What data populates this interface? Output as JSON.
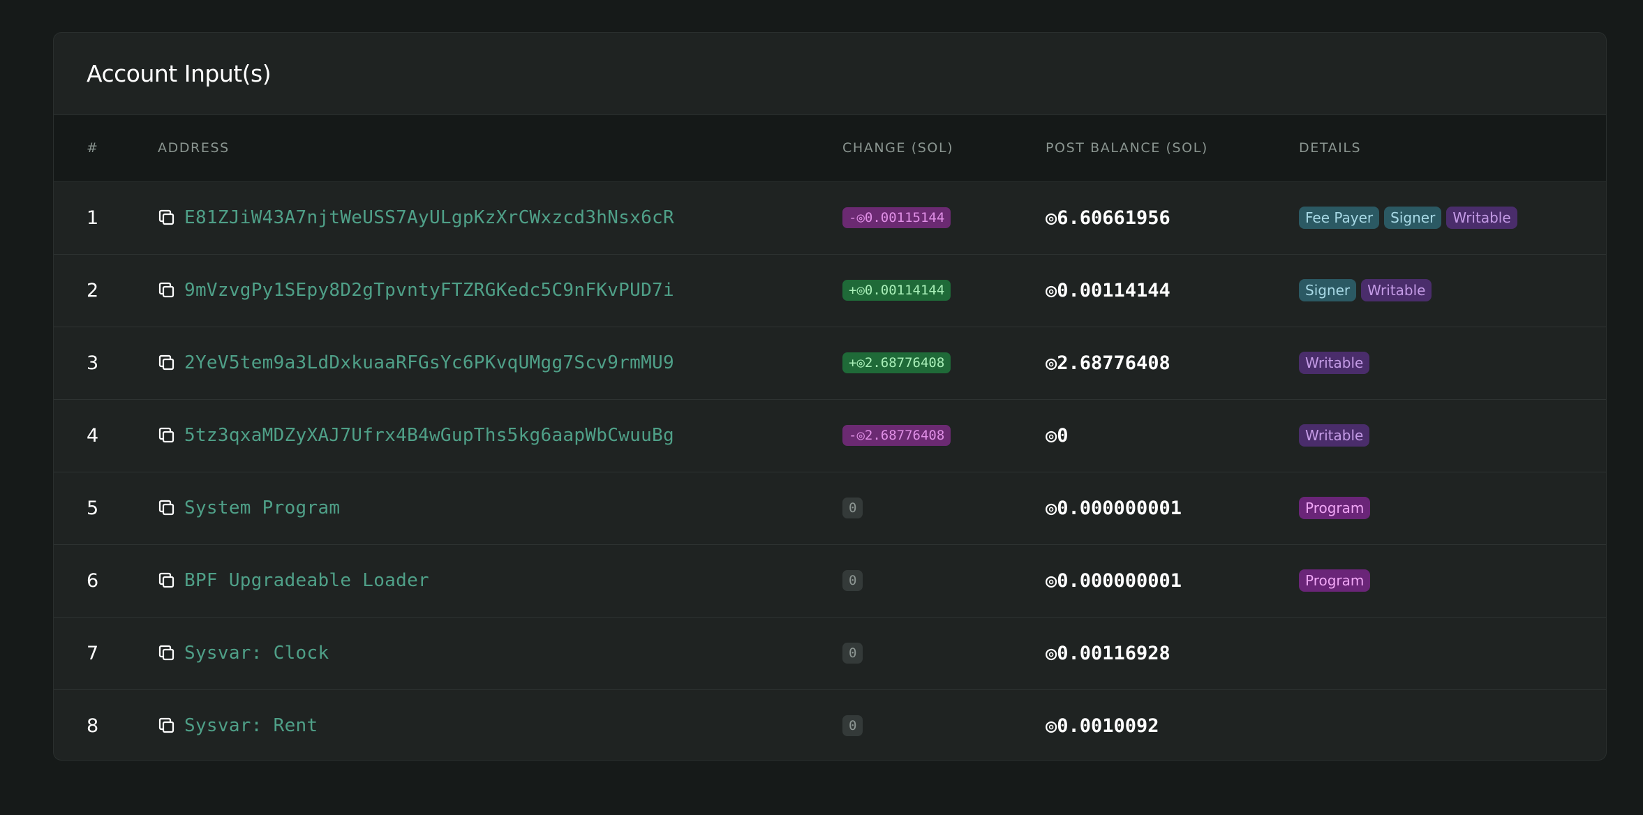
{
  "card": {
    "title": "Account Input(s)"
  },
  "table": {
    "headers": [
      "#",
      "ADDRESS",
      "CHANGE (SOL)",
      "POST BALANCE (SOL)",
      "DETAILS"
    ],
    "rows": [
      {
        "num": "1",
        "address": "E81ZJiW43A7njtWeUSS7AyULgpKzXrCWxzcd3hNsx6cR",
        "change": "-◎0.00115144",
        "change_type": "neg",
        "post": "◎6.60661956",
        "badges": [
          "Fee Payer",
          "Signer",
          "Writable"
        ]
      },
      {
        "num": "2",
        "address": "9mVzvgPy1SEpy8D2gTpvntyFTZRGKedc5C9nFKvPUD7i",
        "change": "+◎0.00114144",
        "change_type": "pos",
        "post": "◎0.00114144",
        "badges": [
          "Signer",
          "Writable"
        ]
      },
      {
        "num": "3",
        "address": "2YeV5tem9a3LdDxkuaaRFGsYc6PKvqUMgg7Scv9rmMU9",
        "change": "+◎2.68776408",
        "change_type": "pos",
        "post": "◎2.68776408",
        "badges": [
          "Writable"
        ]
      },
      {
        "num": "4",
        "address": "5tz3qxaMDZyXAJ7Ufrx4B4wGupThs5kg6aapWbCwuuBg",
        "change": "-◎2.68776408",
        "change_type": "neg",
        "post": "◎0",
        "badges": [
          "Writable"
        ]
      },
      {
        "num": "5",
        "address": "System Program",
        "change": "0",
        "change_type": "zero",
        "post": "◎0.000000001",
        "badges": [
          "Program"
        ]
      },
      {
        "num": "6",
        "address": "BPF Upgradeable Loader",
        "change": "0",
        "change_type": "zero",
        "post": "◎0.000000001",
        "badges": [
          "Program"
        ]
      },
      {
        "num": "7",
        "address": "Sysvar: Clock",
        "change": "0",
        "change_type": "zero",
        "post": "◎0.00116928",
        "badges": []
      },
      {
        "num": "8",
        "address": "Sysvar: Rent",
        "change": "0",
        "change_type": "zero",
        "post": "◎0.0010092",
        "badges": []
      }
    ]
  },
  "icons": {
    "copy": "copy-icon"
  },
  "colors": {
    "address": "#4fa088",
    "negative_change_bg": "#6b2a72",
    "positive_change_bg": "#1f6a38",
    "signer_badge_bg": "#2b5963",
    "writable_badge_bg": "#4a2d6b",
    "program_badge_bg": "#6a2578"
  }
}
